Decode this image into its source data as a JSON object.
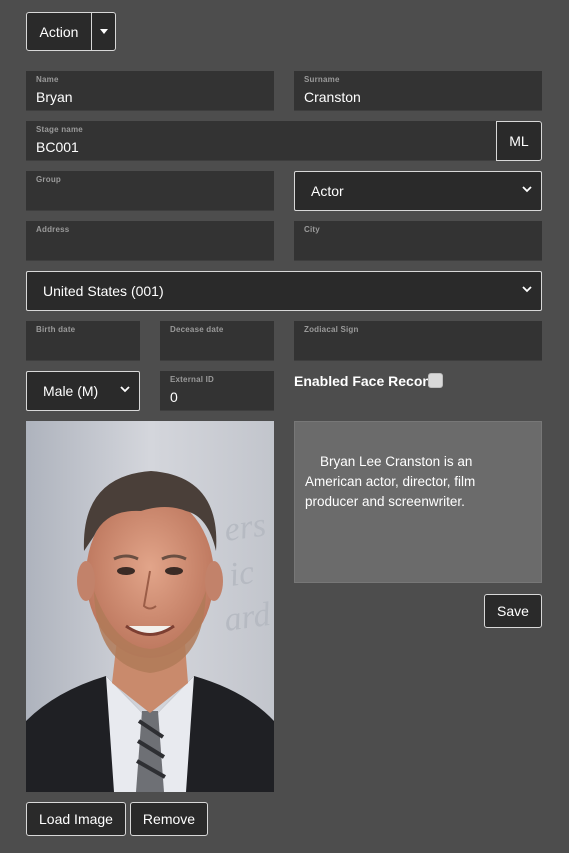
{
  "toolbar": {
    "action_label": "Action",
    "dropdown_icon": "caret-down-icon"
  },
  "form": {
    "name": {
      "label": "Name",
      "value": "Bryan"
    },
    "surname": {
      "label": "Surname",
      "value": "Cranston"
    },
    "stage_name": {
      "label": "Stage name",
      "value": "BC001"
    },
    "ml_button": "ML",
    "group": {
      "label": "Group",
      "value": ""
    },
    "role_select": {
      "selected": "Actor"
    },
    "address": {
      "label": "Address",
      "value": ""
    },
    "city": {
      "label": "City",
      "value": ""
    },
    "country_select": {
      "selected": "United States (001)"
    },
    "birth_date": {
      "label": "Birth date",
      "value": ""
    },
    "decease_date": {
      "label": "Decease date",
      "value": ""
    },
    "zodiacal_sign": {
      "label": "Zodiacal Sign",
      "value": ""
    },
    "gender_select": {
      "selected": "Male (M)"
    },
    "external_id": {
      "label": "External ID",
      "value": "0"
    },
    "face_recon": {
      "label": "Enabled Face Recon.",
      "checked": false
    },
    "bio": "Bryan Lee Cranston is an American actor, director, film producer and screenwriter.",
    "save_label": "Save",
    "load_image_label": "Load Image",
    "remove_label": "Remove"
  },
  "colors": {
    "background": "#4d4d4d",
    "field_bg": "#333333",
    "button_bg": "#2a2a2a",
    "textarea_bg": "#6b6b6b",
    "border": "#d8d8d8"
  }
}
